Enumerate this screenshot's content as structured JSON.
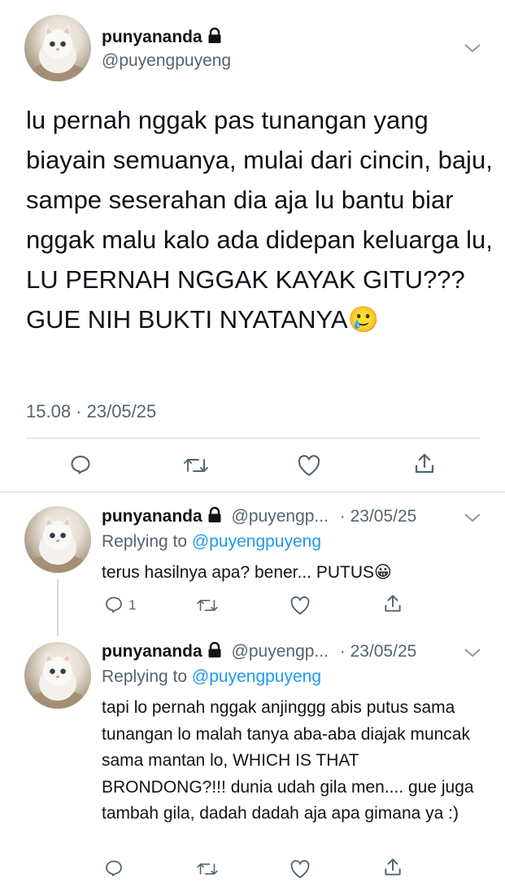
{
  "main_tweet": {
    "name": "punyananda",
    "handle": "@puyengpuyeng",
    "text": "lu pernah nggak pas tunangan yang biayain semuanya, mulai dari cincin, baju, sampe seserahan dia aja lu bantu biar nggak malu kalo ada didepan keluarga lu, LU PERNAH NGGAK KAYAK GITU??? GUE NIH BUKTI NYATANYA",
    "emoji": "🥲",
    "timestamp": "15.08 · 23/05/25"
  },
  "replies": [
    {
      "name": "punyananda",
      "handle": "@puyengp...",
      "date": "· 23/05/25",
      "replying_prefix": "Replying to",
      "replying_handle": "@puyengpuyeng",
      "text": "terus hasilnya apa? bener... PUTUS",
      "emoji": "😀",
      "reply_count": "1"
    },
    {
      "name": "punyananda",
      "handle": "@puyengp...",
      "date": "· 23/05/25",
      "replying_prefix": "Replying to",
      "replying_handle": "@puyengpuyeng",
      "text": "tapi lo pernah nggak anjinggg abis putus sama tunangan lo malah tanya aba-aba diajak muncak sama mantan lo, WHICH IS THAT BRONDONG?!!! dunia udah gila men.... gue juga tambah gila, dadah dadah aja apa gimana ya :)",
      "reply_count": ""
    }
  ],
  "icons": [
    "cat-avatar",
    "lock-icon",
    "chevron-down-icon",
    "reply-icon",
    "retweet-icon",
    "like-icon",
    "share-icon"
  ],
  "colors": {
    "accent": "#1d9bf0",
    "secondary_text": "#536471",
    "divider": "#cfd9de"
  }
}
